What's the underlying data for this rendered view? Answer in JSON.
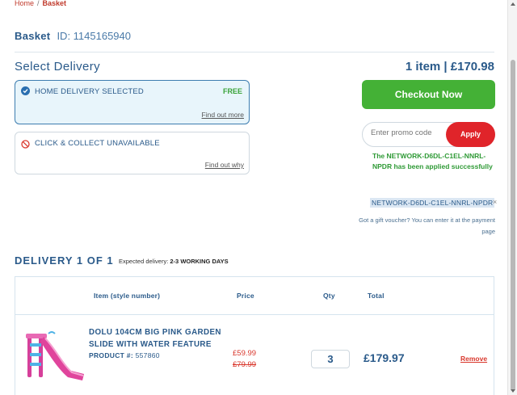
{
  "breadcrumb": {
    "home": "Home",
    "sep": "/",
    "current": "Basket"
  },
  "basket": {
    "title": "Basket",
    "id_label": "ID: 1145165940"
  },
  "delivery_select": {
    "title": "Select Delivery",
    "summary": "1 item | £170.98",
    "home": {
      "label": "HOME DELIVERY SELECTED",
      "badge": "FREE",
      "link": "Find out more"
    },
    "collect": {
      "label": "CLICK & COLLECT UNAVAILABLE",
      "link": "Find out why"
    }
  },
  "checkout": {
    "label": "Checkout Now"
  },
  "promo": {
    "placeholder": "Enter promo code",
    "apply_label": "Apply",
    "success": "The NETWORK-D6DL-C1EL-NNRL-NPDR has been applied successfully",
    "applied_code": "NETWORK-D6DL-C1EL-NNRL-NPDR",
    "remove_symbol": "×",
    "gift_note": "Got a gift voucher? You can enter it at the payment page"
  },
  "delivery": {
    "title": "DELIVERY 1 OF 1",
    "expected_label": "Expected delivery:",
    "expected_value": "2-3 WORKING DAYS"
  },
  "table": {
    "headers": {
      "item": "Item (style number)",
      "price": "Price",
      "qty": "Qty",
      "total": "Total"
    },
    "rows": [
      {
        "name": "DOLU 104CM BIG PINK GARDEN SLIDE WITH WATER FEATURE",
        "product_label": "PRODUCT #:",
        "product_number": "557860",
        "price_now": "£59.99",
        "price_was": "£79.99",
        "qty": "3",
        "total": "£179.97",
        "remove": "Remove"
      }
    ]
  },
  "colors": {
    "primary": "#2a5a8a",
    "checkout_green": "#44b136",
    "apply_red": "#e0242a",
    "success_green": "#2f9a36",
    "price_red": "#d9382d",
    "selected_bg": "#e8f5fb"
  },
  "icons": {
    "selected": "check-circle-icon",
    "unavailable": "no-entry-icon",
    "product": "pink-slide-image"
  }
}
